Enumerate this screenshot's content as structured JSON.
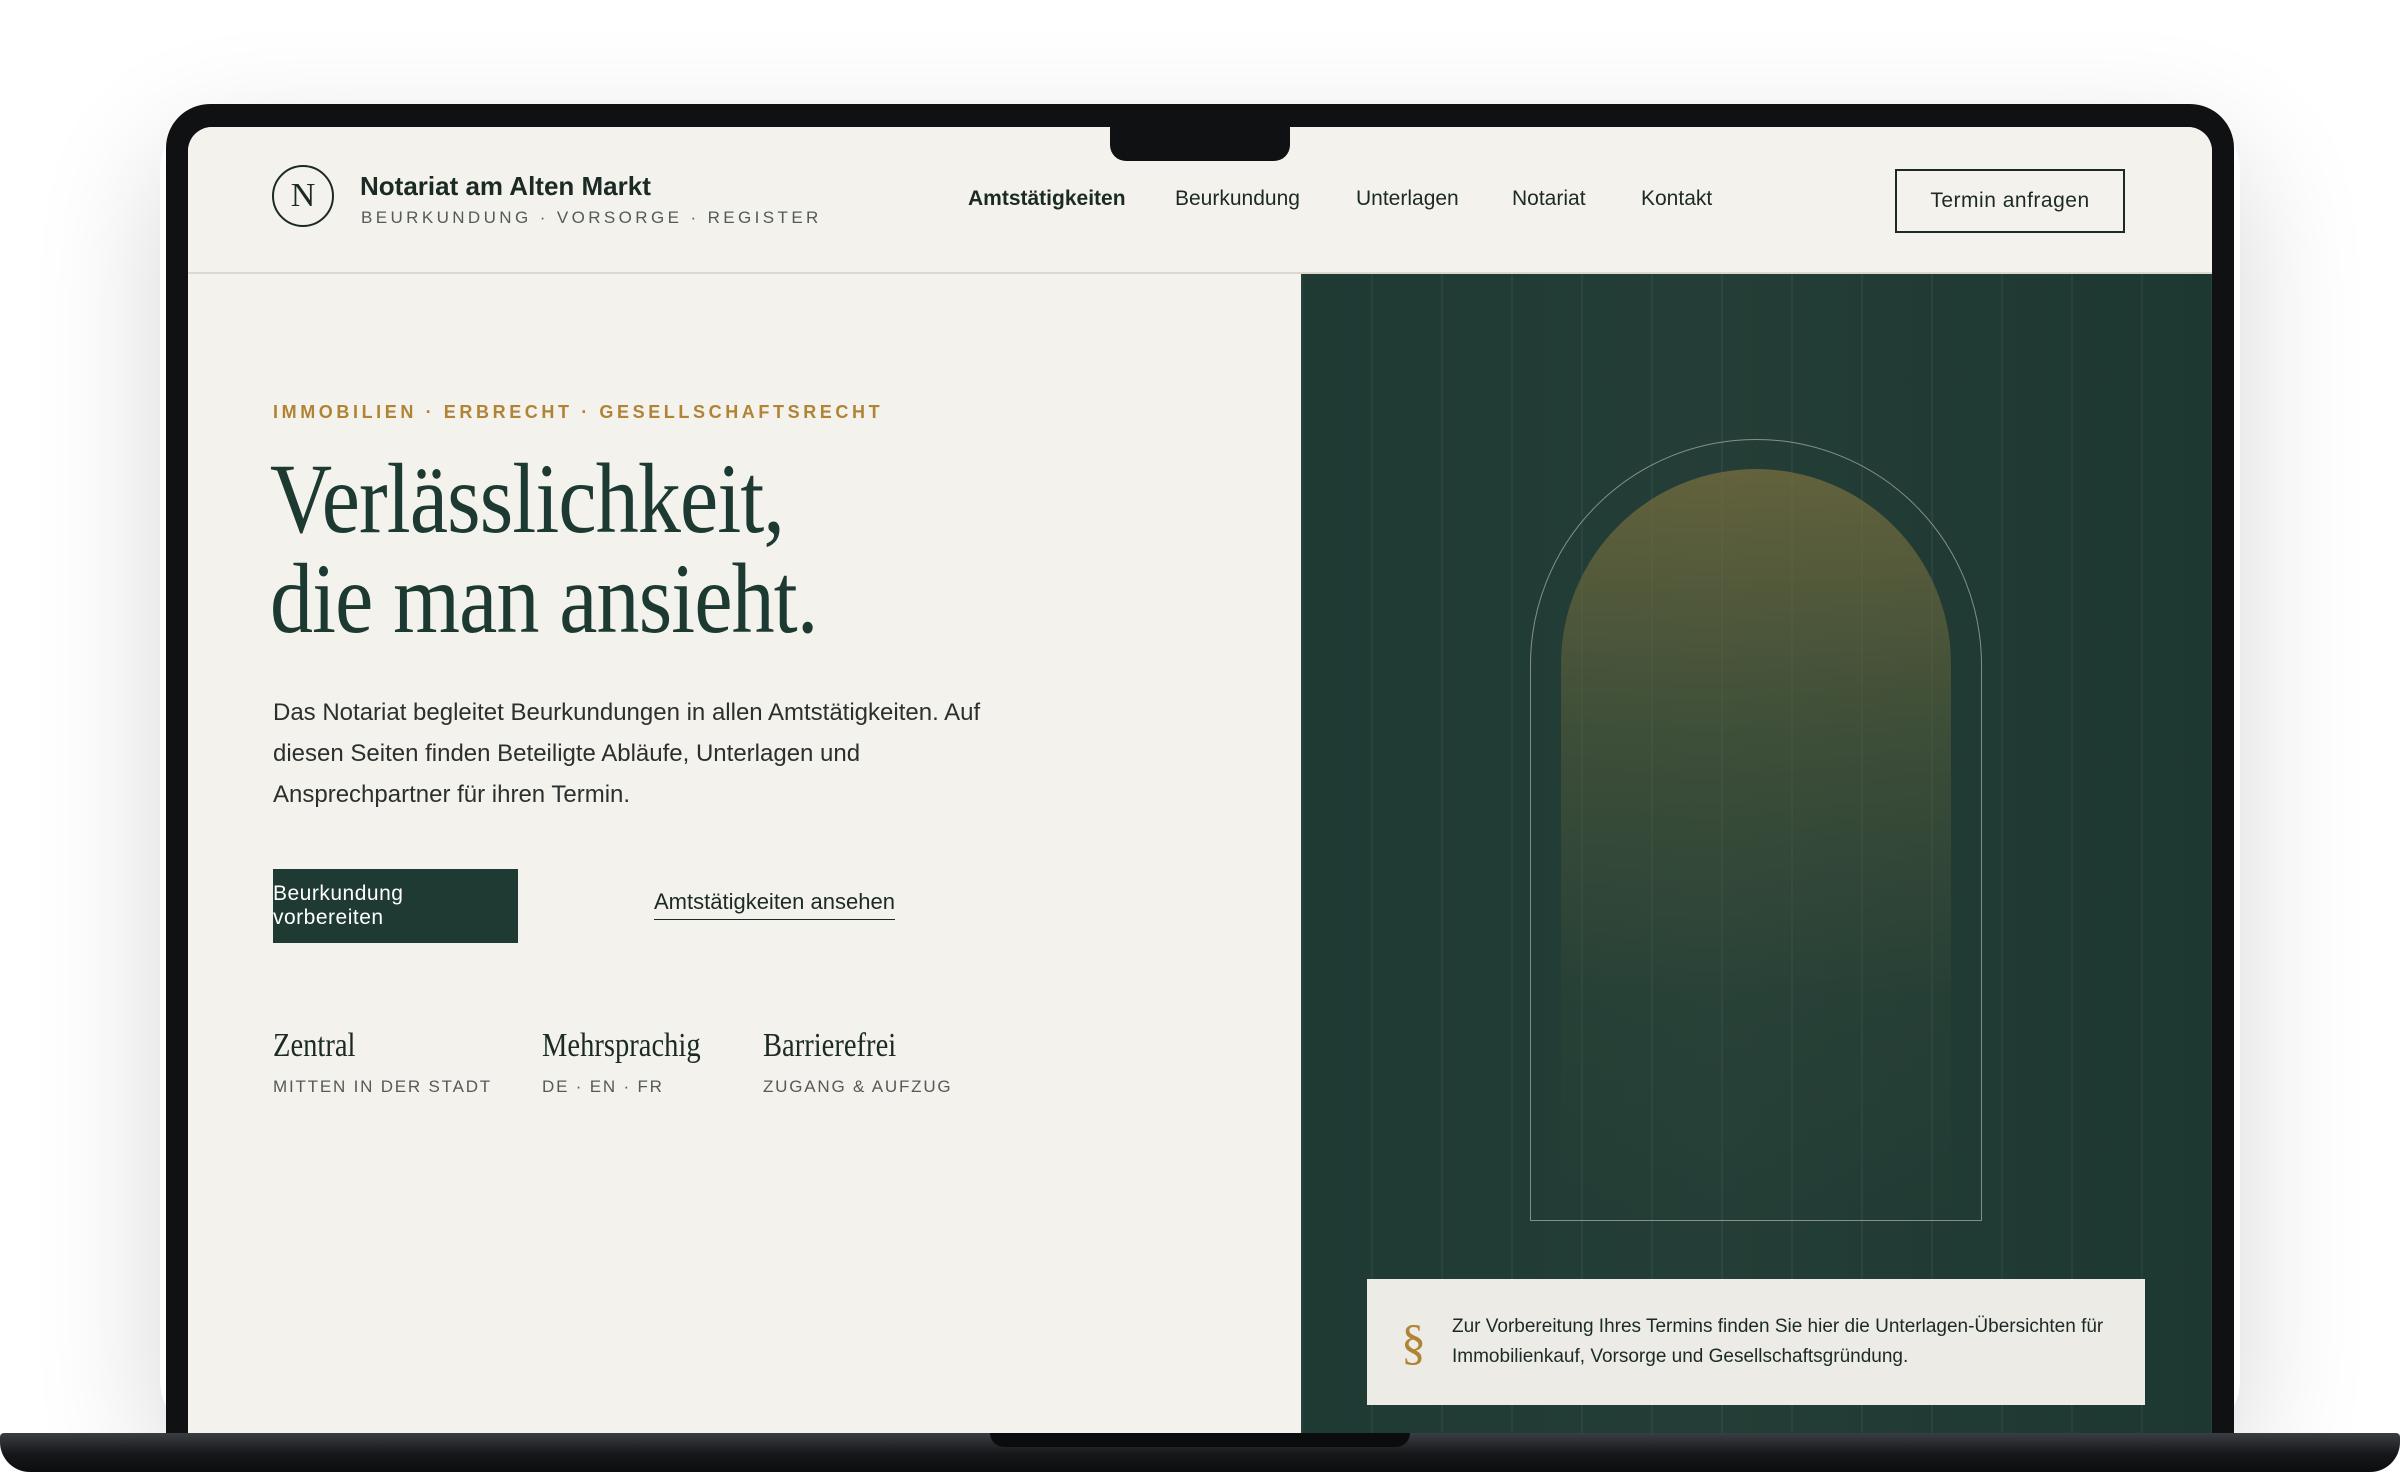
{
  "brand": {
    "logo_letter": "N",
    "name": "Notariat am Alten Markt",
    "tagline": "BEURKUNDUNG · VORSORGE · REGISTER"
  },
  "nav": {
    "items": [
      {
        "label": "Amtstätigkeiten",
        "active": true
      },
      {
        "label": "Beurkundung",
        "active": false
      },
      {
        "label": "Unterlagen",
        "active": false
      },
      {
        "label": "Notariat",
        "active": false
      },
      {
        "label": "Kontakt",
        "active": false
      }
    ],
    "cta": "Termin anfragen"
  },
  "hero": {
    "eyebrow": "IMMOBILIEN · ERBRECHT · GESELLSCHAFTSRECHT",
    "headline_line1": "Verlässlichkeit,",
    "headline_line2": "die man ansieht.",
    "lead": "Das Notariat begleitet Beurkundungen in allen Amtstätigkeiten. Auf diesen Seiten finden Beteiligte Abläufe, Unterlagen und Ansprechpartner für ihren Termin.",
    "primary_button": "Beurkundung vorbereiten",
    "secondary_link": "Amtstätigkeiten ansehen"
  },
  "features": [
    {
      "title": "Zentral",
      "subtitle": "MITTEN IN DER STADT"
    },
    {
      "title": "Mehrsprachig",
      "subtitle": "DE · EN · FR"
    },
    {
      "title": "Barrierefrei",
      "subtitle": "ZUGANG & AUFZUG"
    }
  ],
  "note": {
    "icon": "section-sign-icon",
    "symbol": "§",
    "text": "Zur Vorbereitung Ihres Termins finden Sie hier die Unterlagen-Übersichten für Immobilienkauf, Vorsorge und Gesellschaftsgründung."
  },
  "colors": {
    "accent_gold": "#b08434",
    "deep_green": "#1f3a33",
    "background": "#f4f2ec"
  }
}
